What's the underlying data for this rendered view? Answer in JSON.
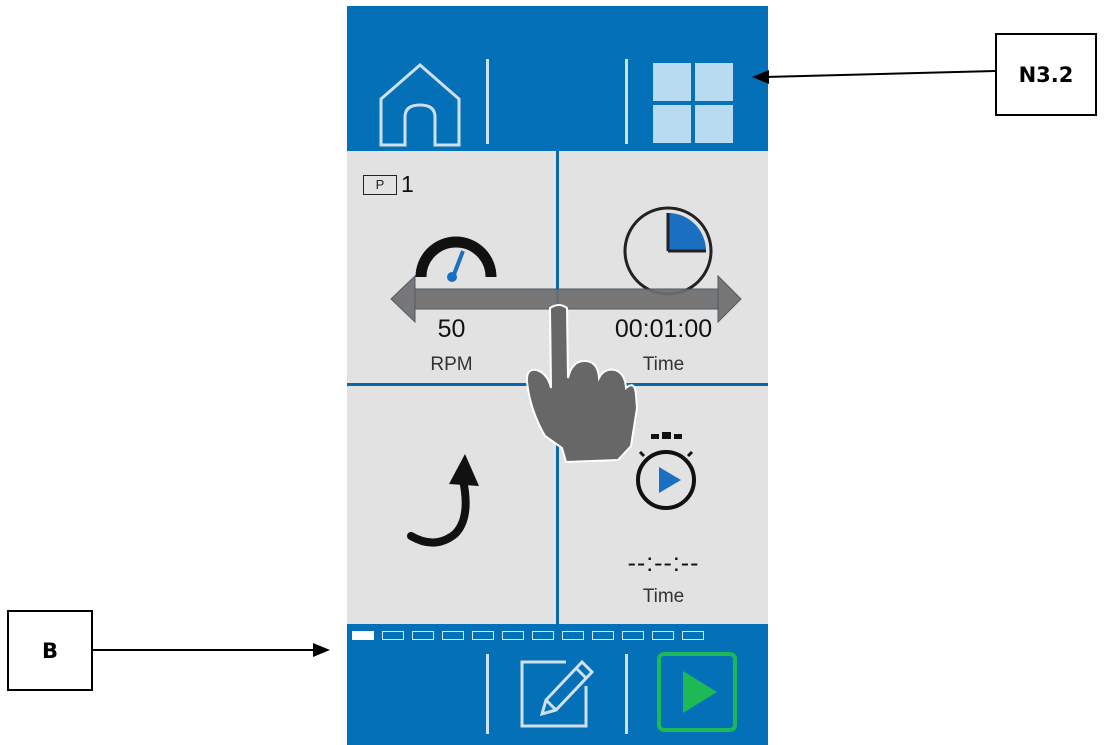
{
  "header": {
    "home_icon": "home-icon",
    "grid_icon": "grid-view-icon"
  },
  "program": {
    "prefix": "P",
    "number": "1"
  },
  "tiles": {
    "speed": {
      "icon": "speedometer-icon",
      "value": "50",
      "label": "RPM"
    },
    "time": {
      "icon": "clock-icon",
      "value": "00:01:00",
      "label": "Time"
    },
    "direction": {
      "icon": "rotation-arrow-icon"
    },
    "timer": {
      "icon": "stopwatch-play-icon",
      "value": "--:--:--",
      "label": "Time"
    }
  },
  "pager": {
    "count": 12,
    "active_index": 0
  },
  "footer": {
    "edit_icon": "edit-pencil-icon",
    "start_icon": "play-icon"
  },
  "gesture": {
    "icon": "swipe-hand-icon"
  },
  "callouts": {
    "top": "N3.2",
    "bottom": "B"
  },
  "colors": {
    "primary_blue": "#0470b8",
    "tile_gray": "#e2e2e2",
    "start_green": "#1db954",
    "accent_blue": "#1a6fc1"
  }
}
